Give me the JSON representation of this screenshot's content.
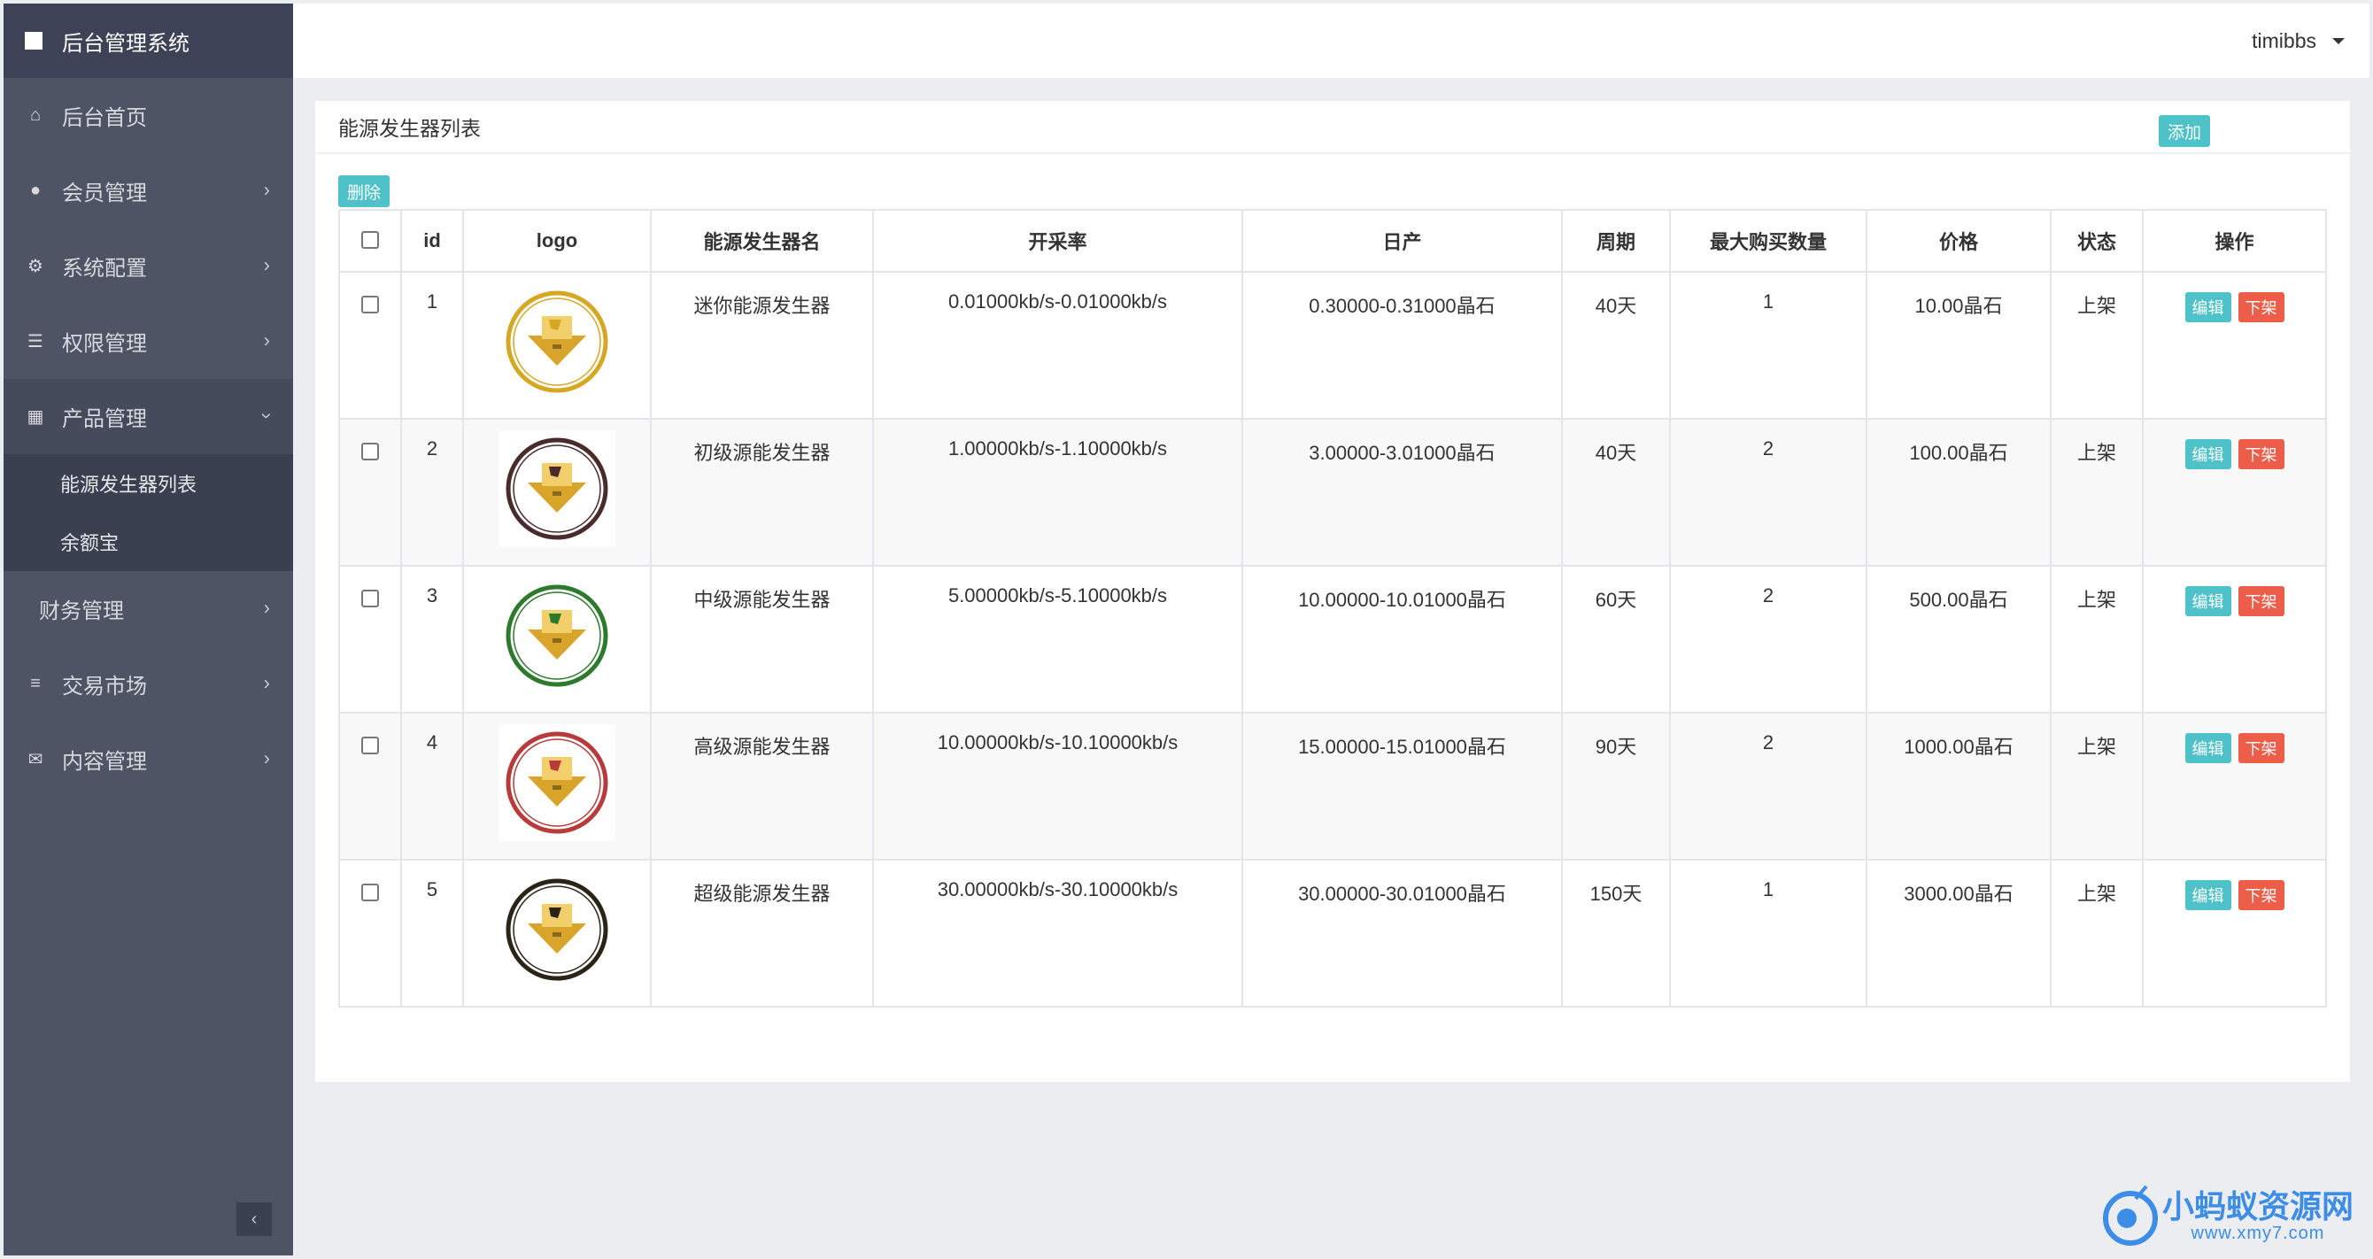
{
  "app": {
    "title": "后台管理系统",
    "user": "timibbs"
  },
  "sidebar": {
    "items": [
      {
        "label": "后台首页",
        "icon": "home-icon",
        "glyph": "⌂"
      },
      {
        "label": "会员管理",
        "icon": "user-icon",
        "glyph": "●"
      },
      {
        "label": "系统配置",
        "icon": "gears-icon",
        "glyph": "⚙"
      },
      {
        "label": "权限管理",
        "icon": "tasks-icon",
        "glyph": "☰"
      },
      {
        "label": "产品管理",
        "icon": "windows-icon",
        "glyph": "▦"
      },
      {
        "label": "财务管理"
      },
      {
        "label": "交易市场",
        "icon": "bars-icon",
        "glyph": "≡"
      },
      {
        "label": "内容管理",
        "icon": "envelope-icon",
        "glyph": "✉"
      }
    ],
    "submenu": [
      "能源发生器列表",
      "余额宝"
    ]
  },
  "panel": {
    "title": "能源发生器列表",
    "add_label": "添加",
    "delete_label": "删除"
  },
  "table": {
    "headers": [
      "id",
      "logo",
      "能源发生器名",
      "开采率",
      "日产",
      "周期",
      "最大购买数量",
      "价格",
      "状态",
      "操作"
    ],
    "edit_label": "编辑",
    "off_label": "下架",
    "rows": [
      {
        "id": "1",
        "name": "迷你能源发生器",
        "rate": "0.01000kb/s-0.01000kb/s",
        "daily": "0.30000-0.31000晶石",
        "period": "40天",
        "max": "1",
        "price": "10.00晶石",
        "status": "上架",
        "ring_color": "#d6a723"
      },
      {
        "id": "2",
        "name": "初级源能发生器",
        "rate": "1.00000kb/s-1.10000kb/s",
        "daily": "3.00000-3.01000晶石",
        "period": "40天",
        "max": "2",
        "price": "100.00晶石",
        "status": "上架",
        "ring_color": "#4a2a2a"
      },
      {
        "id": "3",
        "name": "中级源能发生器",
        "rate": "5.00000kb/s-5.10000kb/s",
        "daily": "10.00000-10.01000晶石",
        "period": "60天",
        "max": "2",
        "price": "500.00晶石",
        "status": "上架",
        "ring_color": "#2d7a2d"
      },
      {
        "id": "4",
        "name": "高级源能发生器",
        "rate": "10.00000kb/s-10.10000kb/s",
        "daily": "15.00000-15.01000晶石",
        "period": "90天",
        "max": "2",
        "price": "1000.00晶石",
        "status": "上架",
        "ring_color": "#b83a3a"
      },
      {
        "id": "5",
        "name": "超级能源发生器",
        "rate": "30.00000kb/s-30.10000kb/s",
        "daily": "30.00000-30.01000晶石",
        "period": "150天",
        "max": "1",
        "price": "3000.00晶石",
        "status": "上架",
        "ring_color": "#2a2418"
      }
    ]
  },
  "watermark": {
    "text": "小蚂蚁资源网",
    "url": "www.xmy7.com"
  },
  "colors": {
    "sidebar_bg": "#4f5464",
    "accent": "#4fc1c8",
    "danger": "#ec5e4a"
  }
}
